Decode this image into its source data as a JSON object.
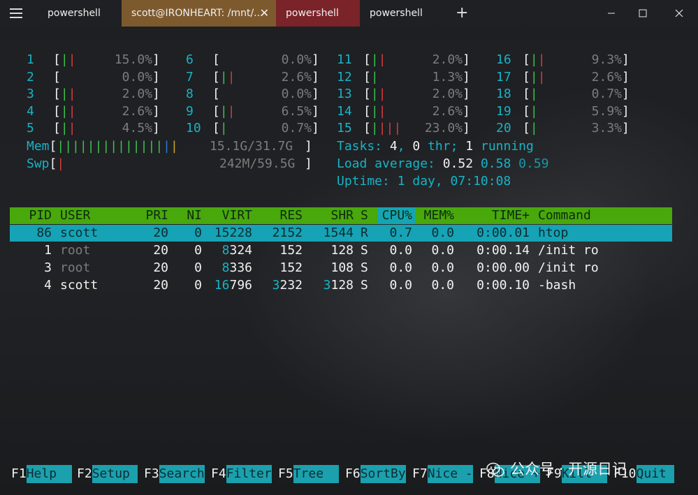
{
  "titlebar": {
    "tabs": [
      {
        "label": "powershell",
        "active": false,
        "color": "#1e2023"
      },
      {
        "label": "scott@IRONHEART: /mnt/...",
        "active": true,
        "color": "#7d5a2e"
      },
      {
        "label": "powershell",
        "active": false,
        "color": "#7a2328"
      },
      {
        "label": "powershell",
        "active": false,
        "color": "#1e2023"
      }
    ],
    "new_tab_label": "+",
    "close_tab_label": "✕"
  },
  "cpu_meters": [
    {
      "id": "1",
      "bar": "||",
      "value": "15.0%"
    },
    {
      "id": "2",
      "bar": "",
      "value": "0.0%"
    },
    {
      "id": "3",
      "bar": "||",
      "value": "2.0%"
    },
    {
      "id": "4",
      "bar": "||",
      "value": "2.6%"
    },
    {
      "id": "5",
      "bar": "||",
      "value": "4.5%"
    },
    {
      "id": "6",
      "bar": "",
      "value": "0.0%"
    },
    {
      "id": "7",
      "bar": "||",
      "value": "2.6%"
    },
    {
      "id": "8",
      "bar": "",
      "value": "0.0%"
    },
    {
      "id": "9",
      "bar": "||",
      "value": "6.5%"
    },
    {
      "id": "10",
      "bar": "|",
      "value": "0.7%"
    },
    {
      "id": "11",
      "bar": "||",
      "value": "2.0%"
    },
    {
      "id": "12",
      "bar": "|",
      "value": "1.3%"
    },
    {
      "id": "13",
      "bar": "||",
      "value": "2.0%"
    },
    {
      "id": "14",
      "bar": "||",
      "value": "2.6%"
    },
    {
      "id": "15",
      "bar": "||||",
      "value": "23.0%"
    },
    {
      "id": "16",
      "bar": "||",
      "value": "9.3%"
    },
    {
      "id": "17",
      "bar": "||",
      "value": "2.6%"
    },
    {
      "id": "18",
      "bar": "|",
      "value": "0.7%"
    },
    {
      "id": "19",
      "bar": "|",
      "value": "5.9%"
    },
    {
      "id": "20",
      "bar": "|",
      "value": "3.3%"
    }
  ],
  "mem": {
    "label": "Mem",
    "bar": "||||||||||||||||",
    "value": "15.1G/31.7G"
  },
  "swp": {
    "label": "Swp",
    "bar": "|",
    "value": "242M/59.5G"
  },
  "tasks": {
    "label": "Tasks:",
    "count": "4",
    "thr_count": "0",
    "thr_label": "thr;",
    "running_count": "1",
    "running_label": "running"
  },
  "load": {
    "label": "Load average:",
    "v1": "0.52",
    "v5": "0.58",
    "v15": "0.59"
  },
  "uptime": {
    "label": "Uptime:",
    "value": "1 day, 07:10:08"
  },
  "columns": [
    "PID",
    "USER",
    "PRI",
    "NI",
    "VIRT",
    "RES",
    "SHR",
    "S",
    "CPU%",
    "MEM%",
    "TIME+",
    "Command"
  ],
  "processes": [
    {
      "pid": "86",
      "user": "scott",
      "pri": "20",
      "ni": "0",
      "virt": "15228",
      "res": "2152",
      "shr": "1544",
      "s": "R",
      "cpu": "0.7",
      "mem": "0.0",
      "time": "0:00.01",
      "cmd": "htop"
    },
    {
      "pid": "1",
      "user": "root",
      "pri": "20",
      "ni": "0",
      "virt": "8324",
      "res": "152",
      "shr": "128",
      "s": "S",
      "cpu": "0.0",
      "mem": "0.0",
      "time": "0:00.14",
      "cmd": "/init ro"
    },
    {
      "pid": "3",
      "user": "root",
      "pri": "20",
      "ni": "0",
      "virt": "8336",
      "res": "152",
      "shr": "108",
      "s": "S",
      "cpu": "0.0",
      "mem": "0.0",
      "time": "0:00.00",
      "cmd": "/init ro"
    },
    {
      "pid": "4",
      "user": "scott",
      "pri": "20",
      "ni": "0",
      "virt": "16796",
      "res": "3232",
      "shr": "3128",
      "s": "S",
      "cpu": "0.0",
      "mem": "0.0",
      "time": "0:00.10",
      "cmd": "-bash"
    }
  ],
  "function_keys": [
    {
      "key": "F1",
      "label": "Help  "
    },
    {
      "key": "F2",
      "label": "Setup "
    },
    {
      "key": "F3",
      "label": "Search"
    },
    {
      "key": "F4",
      "label": "Filter"
    },
    {
      "key": "F5",
      "label": "Tree  "
    },
    {
      "key": "F6",
      "label": "SortBy"
    },
    {
      "key": "F7",
      "label": "Nice -"
    },
    {
      "key": "F8",
      "label": "Nice +"
    },
    {
      "key": "F9",
      "label": "Kill  "
    },
    {
      "key": "F10",
      "label": "Quit "
    }
  ],
  "watermark": {
    "text": "公众号 · 开源日记",
    "icon": "wechat-icon"
  }
}
